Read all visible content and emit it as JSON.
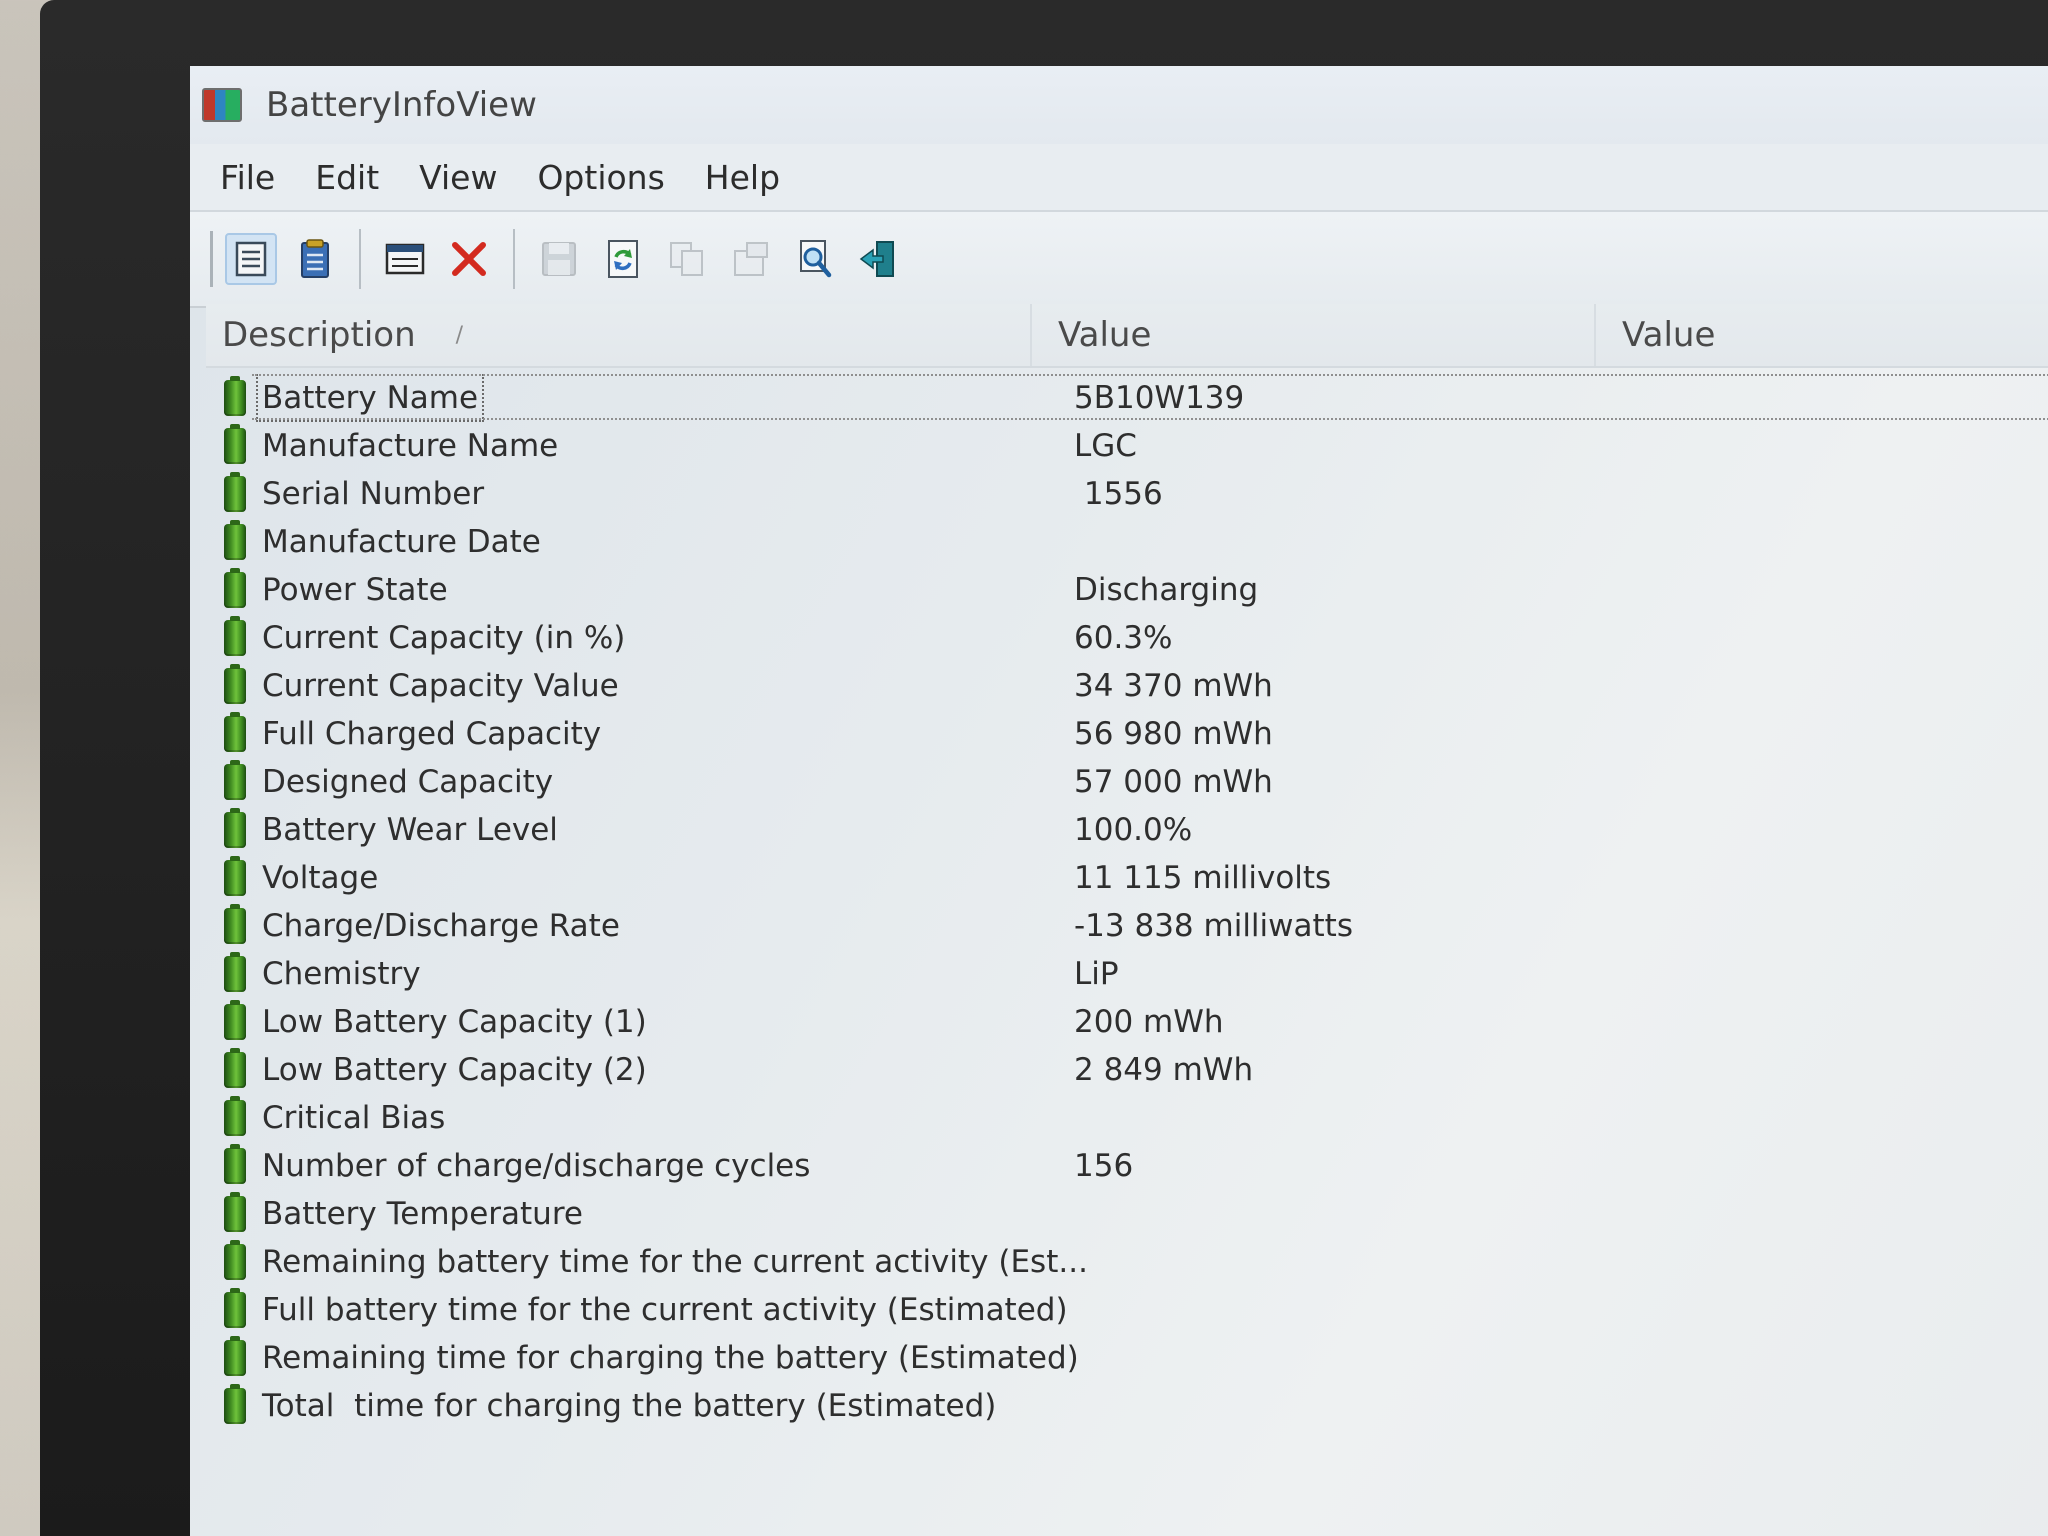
{
  "window": {
    "title": "BatteryInfoView"
  },
  "menu": [
    {
      "label": "File"
    },
    {
      "label": "Edit"
    },
    {
      "label": "View"
    },
    {
      "label": "Options"
    },
    {
      "label": "Help"
    }
  ],
  "toolbar": {
    "buttons": [
      {
        "icon": "properties-view-icon",
        "active": true
      },
      {
        "icon": "clipboard-icon"
      },
      {
        "icon": "log-window-icon"
      },
      {
        "icon": "delete-x-icon"
      },
      {
        "icon": "save-icon",
        "disabled": true
      },
      {
        "icon": "refresh-icon"
      },
      {
        "icon": "copy-icon",
        "disabled": true
      },
      {
        "icon": "properties-icon",
        "disabled": true
      },
      {
        "icon": "find-icon"
      },
      {
        "icon": "exit-icon"
      }
    ]
  },
  "list": {
    "columns": {
      "description": "Description",
      "sort_indicator": "/",
      "value": "Value",
      "value2": "Value"
    },
    "rows": [
      {
        "description": "Battery Name",
        "value": "5B10W139"
      },
      {
        "description": "Manufacture Name",
        "value": "LGC"
      },
      {
        "description": "Serial Number",
        "value": " 1556"
      },
      {
        "description": "Manufacture Date",
        "value": ""
      },
      {
        "description": "Power State",
        "value": "Discharging"
      },
      {
        "description": "Current Capacity (in %)",
        "value": "60.3%"
      },
      {
        "description": "Current Capacity Value",
        "value": "34 370 mWh"
      },
      {
        "description": "Full Charged Capacity",
        "value": "56 980 mWh"
      },
      {
        "description": "Designed Capacity",
        "value": "57 000 mWh"
      },
      {
        "description": "Battery Wear Level",
        "value": "100.0%"
      },
      {
        "description": "Voltage",
        "value": "11 115 millivolts"
      },
      {
        "description": "Charge/Discharge Rate",
        "value": "-13 838 milliwatts"
      },
      {
        "description": "Chemistry",
        "value": "LiP"
      },
      {
        "description": "Low Battery Capacity (1)",
        "value": "200 mWh"
      },
      {
        "description": "Low Battery Capacity (2)",
        "value": "2 849 mWh"
      },
      {
        "description": "Critical Bias",
        "value": ""
      },
      {
        "description": "Number of charge/discharge cycles",
        "value": "156"
      },
      {
        "description": "Battery Temperature",
        "value": ""
      },
      {
        "description": "Remaining battery time for the current activity (Est...",
        "value": ""
      },
      {
        "description": "Full battery time for the current activity (Estimated)",
        "value": ""
      },
      {
        "description": "Remaining time for charging the battery (Estimated)",
        "value": ""
      },
      {
        "description": "Total  time for charging the battery (Estimated)",
        "value": ""
      }
    ]
  }
}
